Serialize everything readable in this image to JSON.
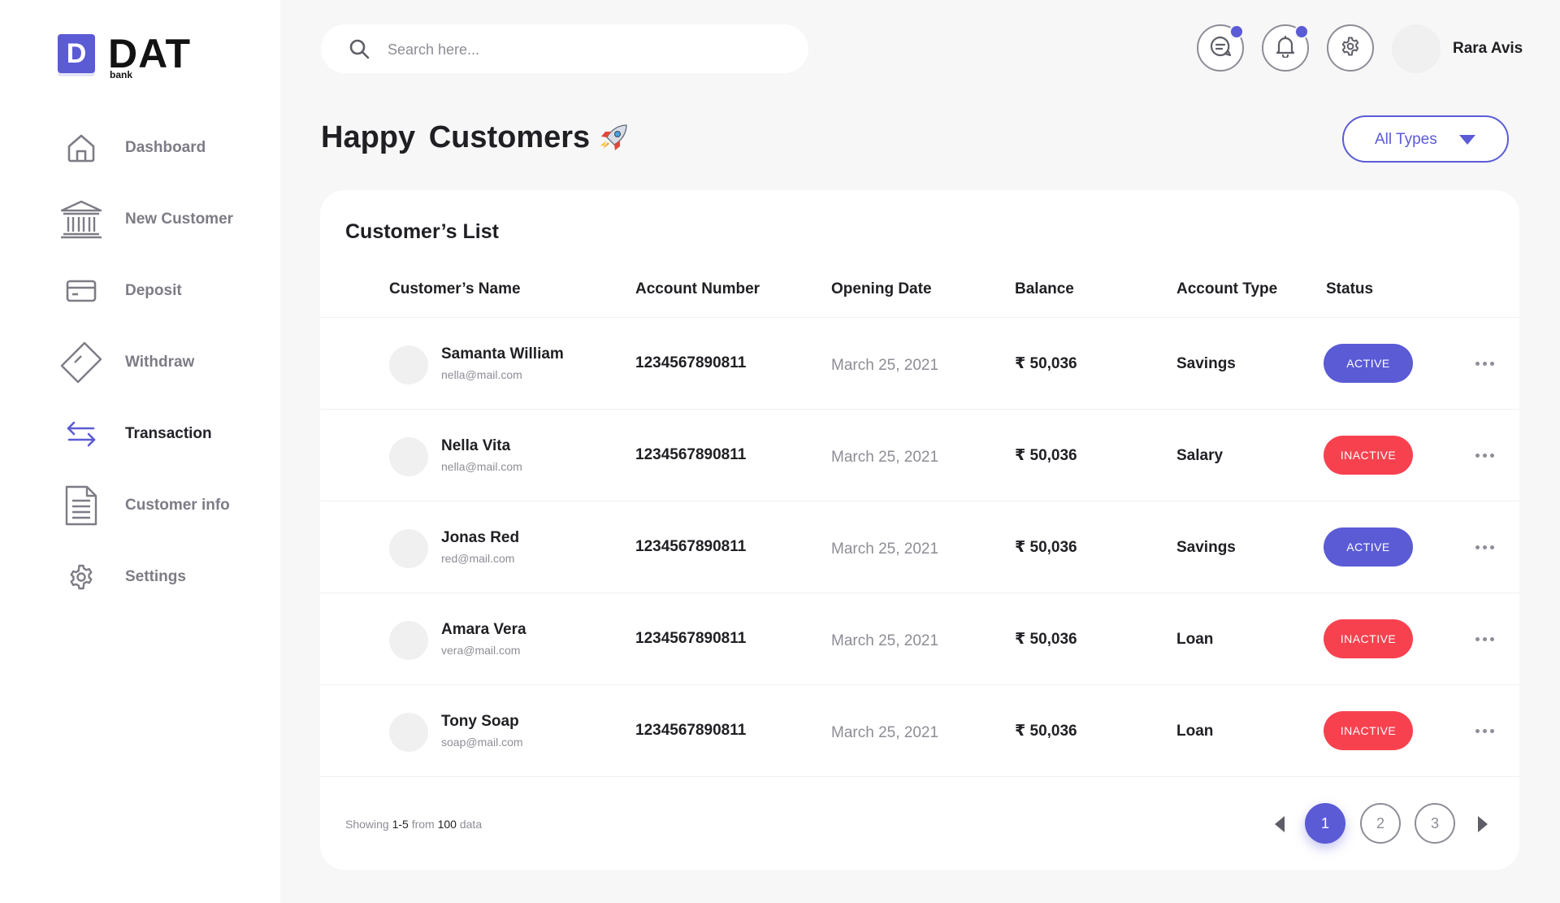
{
  "brand": {
    "mark": "D",
    "name": "DAT",
    "sub": "bank"
  },
  "sidebar": {
    "items": [
      {
        "label": "Dashboard",
        "icon": "home-icon",
        "active": false
      },
      {
        "label": "New Customer",
        "icon": "bank-icon",
        "active": false
      },
      {
        "label": "Deposit",
        "icon": "card-icon",
        "active": false
      },
      {
        "label": "Withdraw",
        "icon": "ticket-icon",
        "active": false
      },
      {
        "label": "Transaction",
        "icon": "arrows-swap-icon",
        "active": true
      },
      {
        "label": "Customer info",
        "icon": "document-icon",
        "active": false
      },
      {
        "label": "Settings",
        "icon": "gear-icon",
        "active": false
      }
    ]
  },
  "header": {
    "search_placeholder": "Search here...",
    "user_name": "Rara Avis",
    "icons": [
      "chat-icon",
      "bell-icon",
      "gear-icon"
    ]
  },
  "page": {
    "title": "Happy  Customers",
    "filter_label": "All Types"
  },
  "table": {
    "title": "Customer’s List",
    "columns": [
      "Customer’s Name",
      "Account Number",
      "Opening Date",
      "Balance",
      "Account Type",
      "Status"
    ],
    "rows": [
      {
        "name": "Samanta William",
        "email": "nella@mail.com",
        "account": "1234567890811",
        "date": "March 25, 2021",
        "balance": "₹ 50,036",
        "type": "Savings",
        "status": "ACTIVE"
      },
      {
        "name": "Nella Vita",
        "email": "nella@mail.com",
        "account": "1234567890811",
        "date": "March 25, 2021",
        "balance": "₹ 50,036",
        "type": "Salary",
        "status": "INACTIVE"
      },
      {
        "name": "Jonas Red",
        "email": "red@mail.com",
        "account": "1234567890811",
        "date": "March 25, 2021",
        "balance": "₹ 50,036",
        "type": "Savings",
        "status": "ACTIVE"
      },
      {
        "name": "Amara Vera",
        "email": "vera@mail.com",
        "account": "1234567890811",
        "date": "March 25, 2021",
        "balance": "₹ 50,036",
        "type": "Loan",
        "status": "INACTIVE"
      },
      {
        "name": "Tony Soap",
        "email": "soap@mail.com",
        "account": "1234567890811",
        "date": "March 25, 2021",
        "balance": "₹ 50,036",
        "type": "Loan",
        "status": "INACTIVE"
      }
    ]
  },
  "pagination": {
    "showing_prefix": "Showing",
    "range": "1-5",
    "from_word": "from",
    "total": "100",
    "suffix": "data",
    "pages": [
      "1",
      "2",
      "3"
    ],
    "current": "1"
  },
  "colors": {
    "accent": "#5b5bd6",
    "active_status": "#5b5bd6",
    "inactive_status": "#f8414f",
    "background": "#f7f7f7",
    "muted_text": "#8d8d96"
  }
}
